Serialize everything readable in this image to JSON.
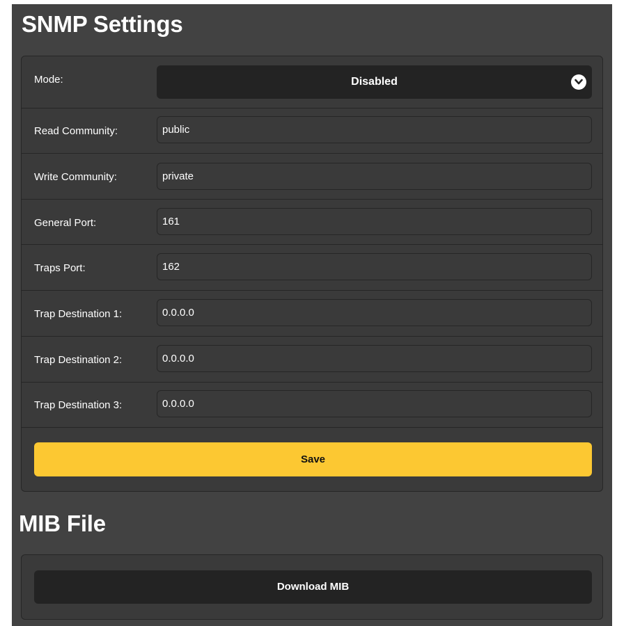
{
  "snmp": {
    "title": "SNMP Settings",
    "mode": {
      "label": "Mode:",
      "value": "Disabled"
    },
    "read_community": {
      "label": "Read Community:",
      "value": "public"
    },
    "write_community": {
      "label": "Write Community:",
      "value": "private"
    },
    "general_port": {
      "label": "General Port:",
      "value": "161"
    },
    "traps_port": {
      "label": "Traps Port:",
      "value": "162"
    },
    "trap_dest_1": {
      "label": "Trap Destination 1:",
      "value": "0.0.0.0"
    },
    "trap_dest_2": {
      "label": "Trap Destination 2:",
      "value": "0.0.0.0"
    },
    "trap_dest_3": {
      "label": "Trap Destination 3:",
      "value": "0.0.0.0"
    },
    "save_label": "Save"
  },
  "mib": {
    "title": "MIB File",
    "download_label": "Download MIB"
  },
  "icons": {
    "mode_dropdown": "chevron-down-icon"
  },
  "colors": {
    "background": "#424242",
    "panel": "#3a3a3a",
    "dark_control": "#232323",
    "save_accent": "#fcc832"
  }
}
